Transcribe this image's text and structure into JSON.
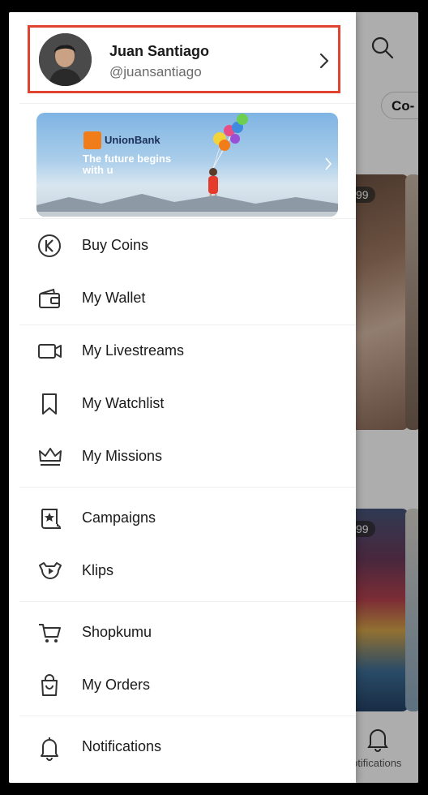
{
  "profile": {
    "name": "Juan Santiago",
    "handle": "@juansantiago"
  },
  "banner": {
    "brand": "UnionBank",
    "tagline": "The future begins with u"
  },
  "menu": [
    {
      "label": "Buy Coins",
      "icon": "coin-k-icon"
    },
    {
      "label": "My Wallet",
      "icon": "wallet-icon"
    },
    {
      "label": "My Livestreams",
      "icon": "video-camera-icon"
    },
    {
      "label": "My Watchlist",
      "icon": "bookmark-icon"
    },
    {
      "label": "My Missions",
      "icon": "crown-icon"
    },
    {
      "label": "Campaigns",
      "icon": "scroll-star-icon"
    },
    {
      "label": "Klips",
      "icon": "play-face-icon"
    },
    {
      "label": "Shopkumu",
      "icon": "cart-icon"
    },
    {
      "label": "My Orders",
      "icon": "shopping-bag-icon"
    },
    {
      "label": "Notifications",
      "icon": "bell-icon"
    }
  ],
  "background": {
    "chip_label": "Co-",
    "badge_1": "99",
    "badge_2": "99",
    "tab_label": "otifications"
  },
  "colors": {
    "highlight": "#e0432f",
    "brand_orange": "#f07d1a"
  }
}
